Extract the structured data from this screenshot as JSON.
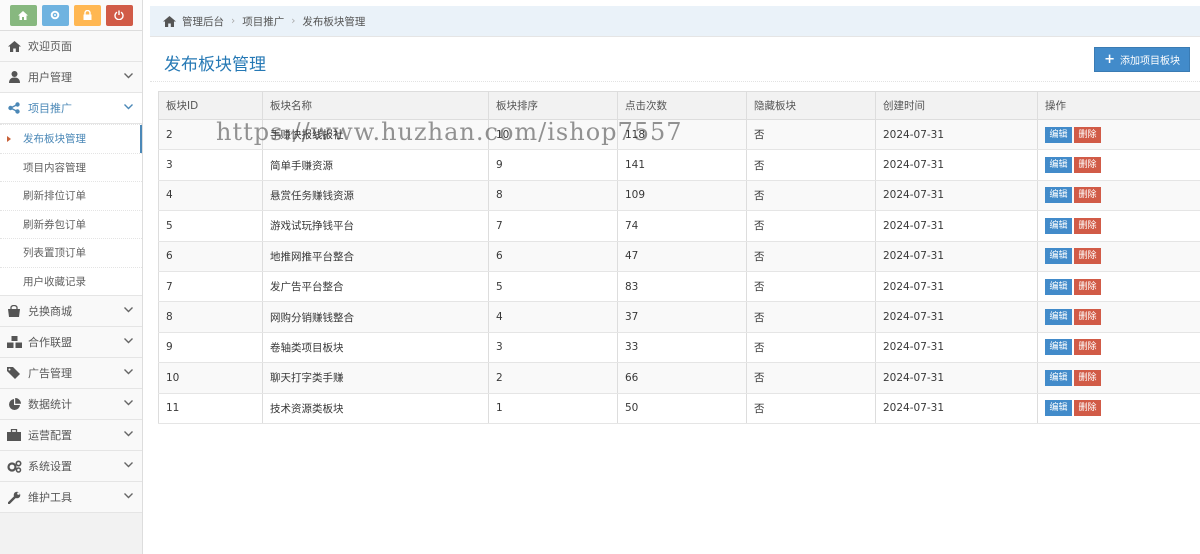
{
  "sidebar": {
    "shortcuts": [
      {
        "icon": "home-icon",
        "color": "#87b87f"
      },
      {
        "icon": "gear-icon",
        "color": "#6fb3e0"
      },
      {
        "icon": "lock-icon",
        "color": "#ffb752"
      },
      {
        "icon": "power-icon",
        "color": "#d15b47"
      }
    ],
    "items": [
      {
        "label": "欢迎页面",
        "icon": "home-icon"
      },
      {
        "label": "用户管理",
        "icon": "user-icon"
      },
      {
        "label": "项目推广",
        "icon": "share-icon"
      },
      {
        "label": "兑换商城",
        "icon": "shop-icon"
      },
      {
        "label": "合作联盟",
        "icon": "cubes-icon"
      },
      {
        "label": "广告管理",
        "icon": "tags-icon"
      },
      {
        "label": "数据统计",
        "icon": "pie-chart-icon"
      },
      {
        "label": "运营配置",
        "icon": "briefcase-icon"
      },
      {
        "label": "系统设置",
        "icon": "cogs-icon"
      },
      {
        "label": "维护工具",
        "icon": "wrench-icon"
      }
    ],
    "submenu": [
      {
        "label": "发布板块管理"
      },
      {
        "label": "项目内容管理"
      },
      {
        "label": "刷新排位订单"
      },
      {
        "label": "刷新券包订单"
      },
      {
        "label": "列表置顶订单"
      },
      {
        "label": "用户收藏记录"
      }
    ]
  },
  "breadcrumb": {
    "items": [
      "管理后台",
      "项目推广",
      "发布板块管理"
    ]
  },
  "page": {
    "title": "发布板块管理",
    "add_button": "添加项目板块"
  },
  "table": {
    "headers": [
      "板块ID",
      "板块名称",
      "板块排序",
      "点击次数",
      "隐藏板块",
      "创建时间",
      "操作"
    ],
    "edit_label": "编辑",
    "delete_label": "删除",
    "rows": [
      {
        "id": "2",
        "name": "手赚快报线报社",
        "sort": "10",
        "clicks": "118",
        "hidden": "否",
        "created": "2024-07-31"
      },
      {
        "id": "3",
        "name": "简单手赚资源",
        "sort": "9",
        "clicks": "141",
        "hidden": "否",
        "created": "2024-07-31"
      },
      {
        "id": "4",
        "name": "悬赏任务赚钱资源",
        "sort": "8",
        "clicks": "109",
        "hidden": "否",
        "created": "2024-07-31"
      },
      {
        "id": "5",
        "name": "游戏试玩挣钱平台",
        "sort": "7",
        "clicks": "74",
        "hidden": "否",
        "created": "2024-07-31"
      },
      {
        "id": "6",
        "name": "地推网推平台整合",
        "sort": "6",
        "clicks": "47",
        "hidden": "否",
        "created": "2024-07-31"
      },
      {
        "id": "7",
        "name": "发广告平台整合",
        "sort": "5",
        "clicks": "83",
        "hidden": "否",
        "created": "2024-07-31"
      },
      {
        "id": "8",
        "name": "网购分销赚钱整合",
        "sort": "4",
        "clicks": "37",
        "hidden": "否",
        "created": "2024-07-31"
      },
      {
        "id": "9",
        "name": "卷轴类项目板块",
        "sort": "3",
        "clicks": "33",
        "hidden": "否",
        "created": "2024-07-31"
      },
      {
        "id": "10",
        "name": "聊天打字类手赚",
        "sort": "2",
        "clicks": "66",
        "hidden": "否",
        "created": "2024-07-31"
      },
      {
        "id": "11",
        "name": "技术资源类板块",
        "sort": "1",
        "clicks": "50",
        "hidden": "否",
        "created": "2024-07-31"
      }
    ]
  },
  "watermark": "https://www.huzhan.com/ishop7557"
}
